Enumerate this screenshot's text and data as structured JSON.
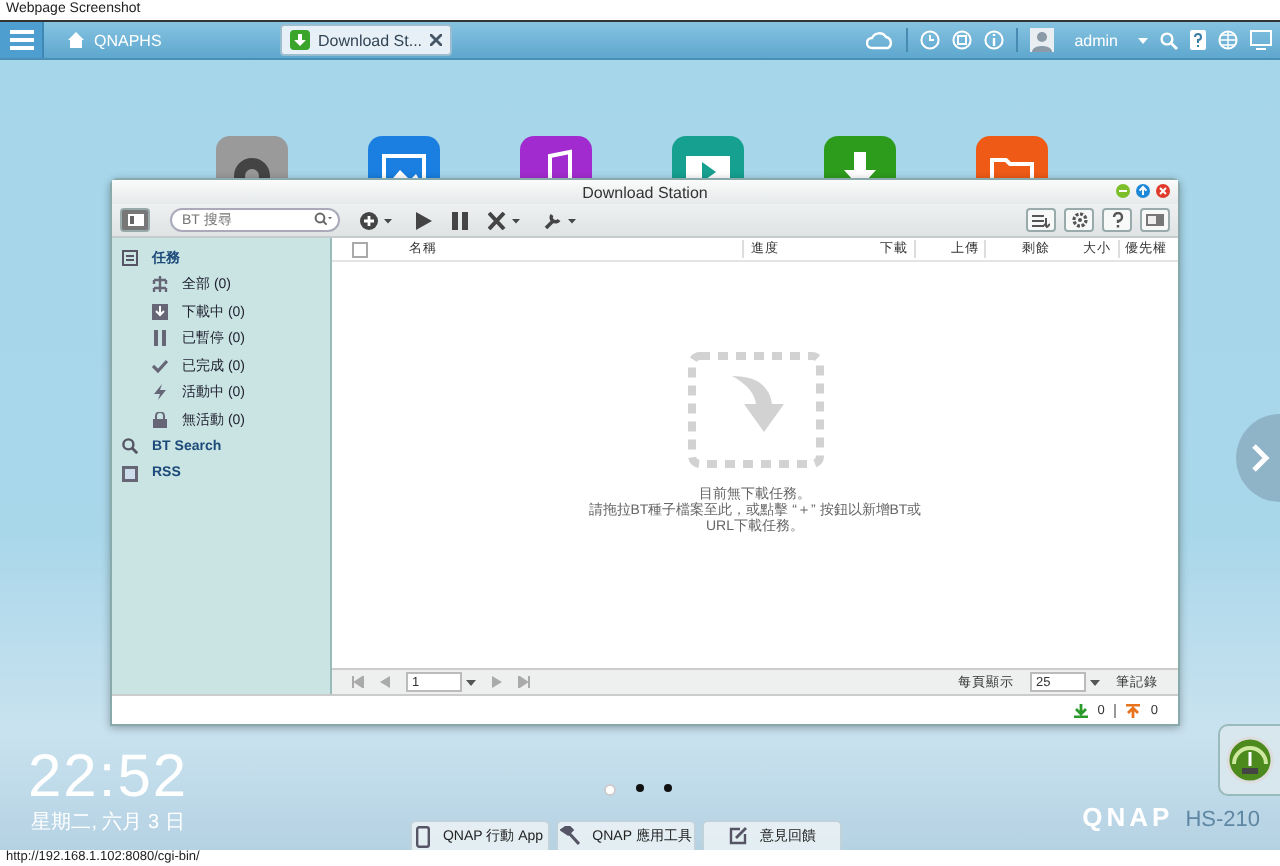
{
  "browser_caption": "Webpage Screenshot",
  "topbar": {
    "home_label": "QNAPHS",
    "tabs": [
      {
        "label": "Download St...",
        "selected": true
      }
    ],
    "user": "admin"
  },
  "window": {
    "title": "Download Station",
    "search": {
      "placeholder": "BT 搜尋"
    },
    "sidebar": [
      {
        "label": "任務",
        "kind": "tasks",
        "children": [
          {
            "label": "全部 (0)",
            "kind": "all"
          },
          {
            "label": "下載中 (0)",
            "kind": "downloading"
          },
          {
            "label": "已暫停 (0)",
            "kind": "paused"
          },
          {
            "label": "已完成 (0)",
            "kind": "completed"
          },
          {
            "label": "活動中 (0)",
            "kind": "active"
          },
          {
            "label": "無活動 (0)",
            "kind": "inactive"
          }
        ]
      },
      {
        "label": "BT Search",
        "kind": "search"
      },
      {
        "label": "RSS",
        "kind": "rss"
      }
    ],
    "header_checkbox": {
      "checked": false
    },
    "columns": [
      "名稱",
      "進度",
      "下載",
      "上傳",
      "剩餘",
      "大小",
      "優先權"
    ],
    "empty_message": [
      "目前無下載任務。",
      "請拖拉BT種子檔案至此，或點擊 “＋” 按鈕以新增BT或",
      "URL下載任務。"
    ],
    "pager": {
      "page": "1",
      "per_page_label": "每頁顯示",
      "per_page": "25",
      "records_label": "筆記錄"
    },
    "status": {
      "download_count": "0",
      "upload_count": "0"
    }
  },
  "desktop": {
    "page_dots": [
      {
        "selected": true
      },
      {
        "selected": false
      },
      {
        "selected": false
      }
    ],
    "clock": {
      "time": "22:52",
      "date": "星期二, 六月 3 日"
    },
    "dock": [
      {
        "label": "QNAP 行動 App",
        "kind": "phone"
      },
      {
        "label": "QNAP 應用工具",
        "kind": "hammer"
      },
      {
        "label": "意見回饋",
        "kind": "feedback"
      }
    ],
    "brand": "QNAP",
    "model": "HS-210"
  },
  "status_url": "http://192.168.1.102:8080/cgi-bin/"
}
